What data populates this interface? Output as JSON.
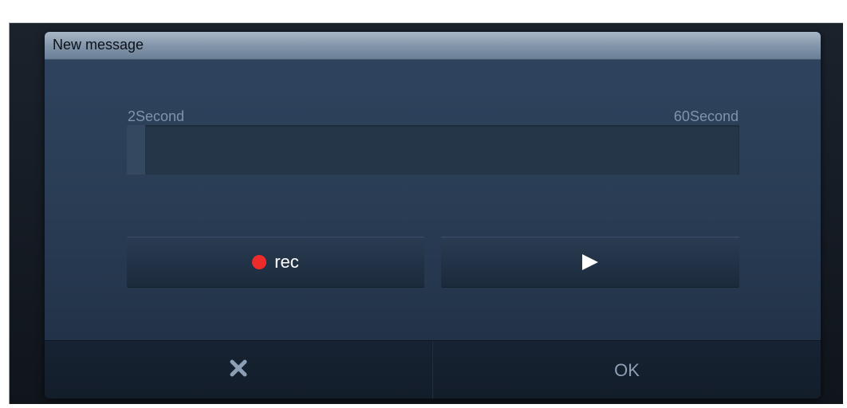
{
  "dialog": {
    "title": "New message",
    "range": {
      "min_label": "2Second",
      "max_label": "60Second",
      "progress_fraction": 0.03
    },
    "buttons": {
      "record_label": "rec",
      "play_icon": "play-icon"
    },
    "footer": {
      "cancel_icon": "close-icon",
      "ok_label": "OK"
    }
  },
  "colors": {
    "record_dot": "#ee2b2b",
    "dialog_background": "#2a3d55",
    "titlebar": "#8799ad",
    "range_label": "#7f93ab"
  }
}
